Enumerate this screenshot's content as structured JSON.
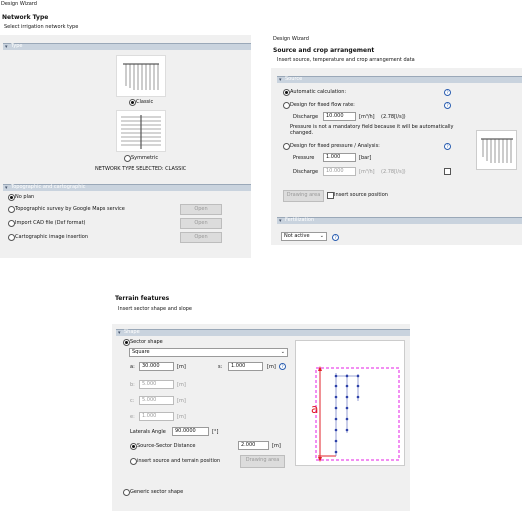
{
  "panel1": {
    "window_title": "Design Wizard",
    "title": "Network Type",
    "subtitle": "Select irrigation network type",
    "type_section": "Type",
    "classic_label": "Classic",
    "symmetric_label": "Symmetric",
    "selected_text": "NETWORK TYPE SELECTED: CLASSIC",
    "topo_section": "Topographic and cartographic",
    "no_plan": "No plan",
    "topo_survey": "Topographic survey by Google Maps service",
    "import_cad": "Import CAD file (Dxf format)",
    "carto_image": "Cartographic image insertion",
    "open_label": "Open"
  },
  "panel2": {
    "window_title": "Design Wizard",
    "title": "Source and crop arrangement",
    "subtitle": "Insert source, temperature and crop arrangement data",
    "source_section": "Source",
    "auto_calc": "Automatic calculation:",
    "fixed_flow": "Design for fixed flow rate:",
    "discharge_label": "Discharge",
    "discharge_value": "10.000",
    "discharge_unit": "[m³/h]",
    "discharge_ls": "(2.78[l/s])",
    "note": "Pressure is not a mandatory field because it will be automatically changed.",
    "fixed_pressure": "Design for fixed pressure / Analysis:",
    "pressure_label": "Pressure",
    "pressure_value": "1.000",
    "pressure_unit": "[bar]",
    "discharge2_label": "Discharge",
    "discharge2_value": "10.000",
    "discharge2_unit": "[m³/h]",
    "discharge2_ls": "(2.78[l/s])",
    "drawing_area": "Drawing area",
    "insert_source": "Insert source position",
    "fert_section": "Fertilization",
    "fert_value": "Not active"
  },
  "panel3": {
    "title": "Terrain features",
    "subtitle": "Insert sector shape and slope",
    "shape_section": "Shape",
    "sector_shape": "Sector shape",
    "shape_value": "Square",
    "a_label": "a:",
    "a_value": "30.000",
    "a_unit": "[m]",
    "s_label": "s:",
    "s_value": "1.000",
    "s_unit": "[m]",
    "b_label": "b:",
    "b_value": "5.000",
    "b_unit": "[m]",
    "c_label": "c:",
    "c_value": "5.000",
    "c_unit": "[m]",
    "e_label": "e:",
    "e_value": "1.000",
    "e_unit": "[m]",
    "laterals_label": "Laterals Angle",
    "laterals_value": "90.0000",
    "laterals_unit": "[°]",
    "ss_distance": "Source-Sector Distance",
    "ss_value": "2.000",
    "ss_unit": "[m]",
    "insert_source_terrain": "insert source and terrain position",
    "drawing_area": "Drawing area",
    "generic_shape": "Generic sector shape",
    "diagram_letter": "a"
  },
  "icons": {
    "help": "?"
  },
  "colors": {
    "accent_magenta": "#e61ee6",
    "dim_red": "#e0202a",
    "dot_blue": "#2b3fa8",
    "section_blue": "#c9d3de"
  }
}
